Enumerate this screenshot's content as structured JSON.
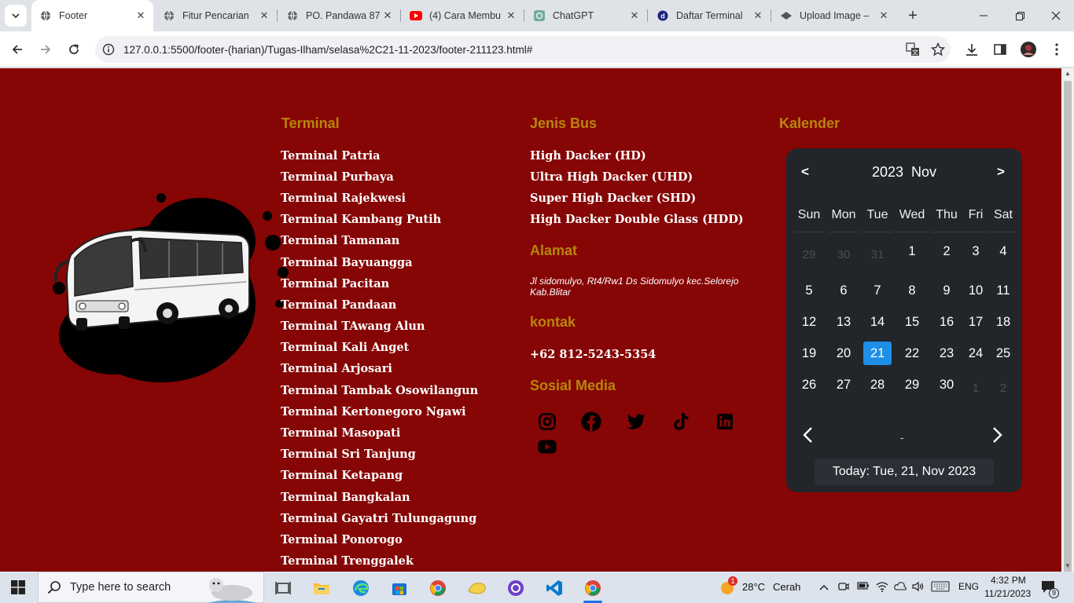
{
  "browser": {
    "tabs": [
      {
        "title": "Footer",
        "active": true
      },
      {
        "title": "Fitur Pencarian",
        "active": false
      },
      {
        "title": "PO. Pandawa 87",
        "active": false
      },
      {
        "title": "(4) Cara Membu",
        "active": false
      },
      {
        "title": "ChatGPT",
        "active": false
      },
      {
        "title": "Daftar Terminal",
        "active": false
      },
      {
        "title": "Upload Image –",
        "active": false
      }
    ],
    "url": "127.0.0.1:5500/footer-(harian)/Tugas-Ilham/selasa%2C21-11-2023/footer-211123.html#"
  },
  "footer": {
    "terminal_title": "Terminal",
    "terminals": [
      "Terminal Patria",
      "Terminal Purbaya",
      "Terminal Rajekwesi",
      "Terminal Kambang Putih",
      "Terminal Tamanan",
      "Terminal Bayuangga",
      "Terminal Pacitan",
      "Terminal Pandaan",
      "Terminal TAwang Alun",
      "Terminal Kali Anget",
      "Terminal Arjosari",
      "Terminal Tambak Osowilangun",
      "Terminal Kertonegoro Ngawi",
      "Terminal Masopati",
      "Terminal Sri Tanjung",
      "Terminal Ketapang",
      "Terminal Bangkalan",
      "Terminal Gayatri Tulungagung",
      "Terminal Ponorogo",
      "Terminal Trenggalek"
    ],
    "bus_title": "Jenis Bus",
    "bus_types": [
      "High Dacker (HD)",
      "Ultra High Dacker (UHD)",
      "Super High Dacker (SHD)",
      "High Dacker Double Glass (HDD)"
    ],
    "address_title": "Alamat",
    "address": "Jl sidomulyo, Rt4/Rw1 Ds Sidomulyo kec.Selorejo Kab.Blitar",
    "contact_title": "kontak",
    "phone": "+62 812-5243-5354",
    "social_title": "Sosial Media",
    "social_icons": [
      "instagram-icon",
      "facebook-icon",
      "twitter-icon",
      "tiktok-icon",
      "linkedin-icon",
      "youtube-icon"
    ],
    "calendar_title": "Kalender"
  },
  "calendar": {
    "prev": "<",
    "next": ">",
    "year": "2023",
    "month": "Nov",
    "weekdays": [
      "Sun",
      "Mon",
      "Tue",
      "Wed",
      "Thu",
      "Fri",
      "Sat"
    ],
    "weeks": [
      [
        {
          "d": "29",
          "m": true
        },
        {
          "d": "30",
          "m": true
        },
        {
          "d": "31",
          "m": true
        },
        {
          "d": "1"
        },
        {
          "d": "2"
        },
        {
          "d": "3"
        },
        {
          "d": "4"
        }
      ],
      [
        {
          "d": "5"
        },
        {
          "d": "6"
        },
        {
          "d": "7"
        },
        {
          "d": "8"
        },
        {
          "d": "9"
        },
        {
          "d": "10"
        },
        {
          "d": "11"
        }
      ],
      [
        {
          "d": "12"
        },
        {
          "d": "13"
        },
        {
          "d": "14"
        },
        {
          "d": "15"
        },
        {
          "d": "16"
        },
        {
          "d": "17"
        },
        {
          "d": "18"
        }
      ],
      [
        {
          "d": "19"
        },
        {
          "d": "20"
        },
        {
          "d": "21",
          "t": true
        },
        {
          "d": "22"
        },
        {
          "d": "23"
        },
        {
          "d": "24"
        },
        {
          "d": "25"
        }
      ],
      [
        {
          "d": "26"
        },
        {
          "d": "27"
        },
        {
          "d": "28"
        },
        {
          "d": "29"
        },
        {
          "d": "30"
        },
        {
          "d": "1",
          "m": true
        },
        {
          "d": "2",
          "m": true
        }
      ]
    ],
    "range_dash": "-",
    "today_label": "Today: Tue, 21, Nov 2023"
  },
  "taskbar": {
    "search_placeholder": "Type here to search",
    "weather_temp": "28°C",
    "weather_desc": "Cerah",
    "weather_badge": "1",
    "lang": "ENG",
    "time": "4:32 PM",
    "date": "11/21/2023",
    "notifications": "9"
  },
  "colors": {
    "page_bg": "#860505",
    "heading": "#b8860b",
    "calendar_bg": "#22252a",
    "today_highlight": "#1e8fe6"
  }
}
